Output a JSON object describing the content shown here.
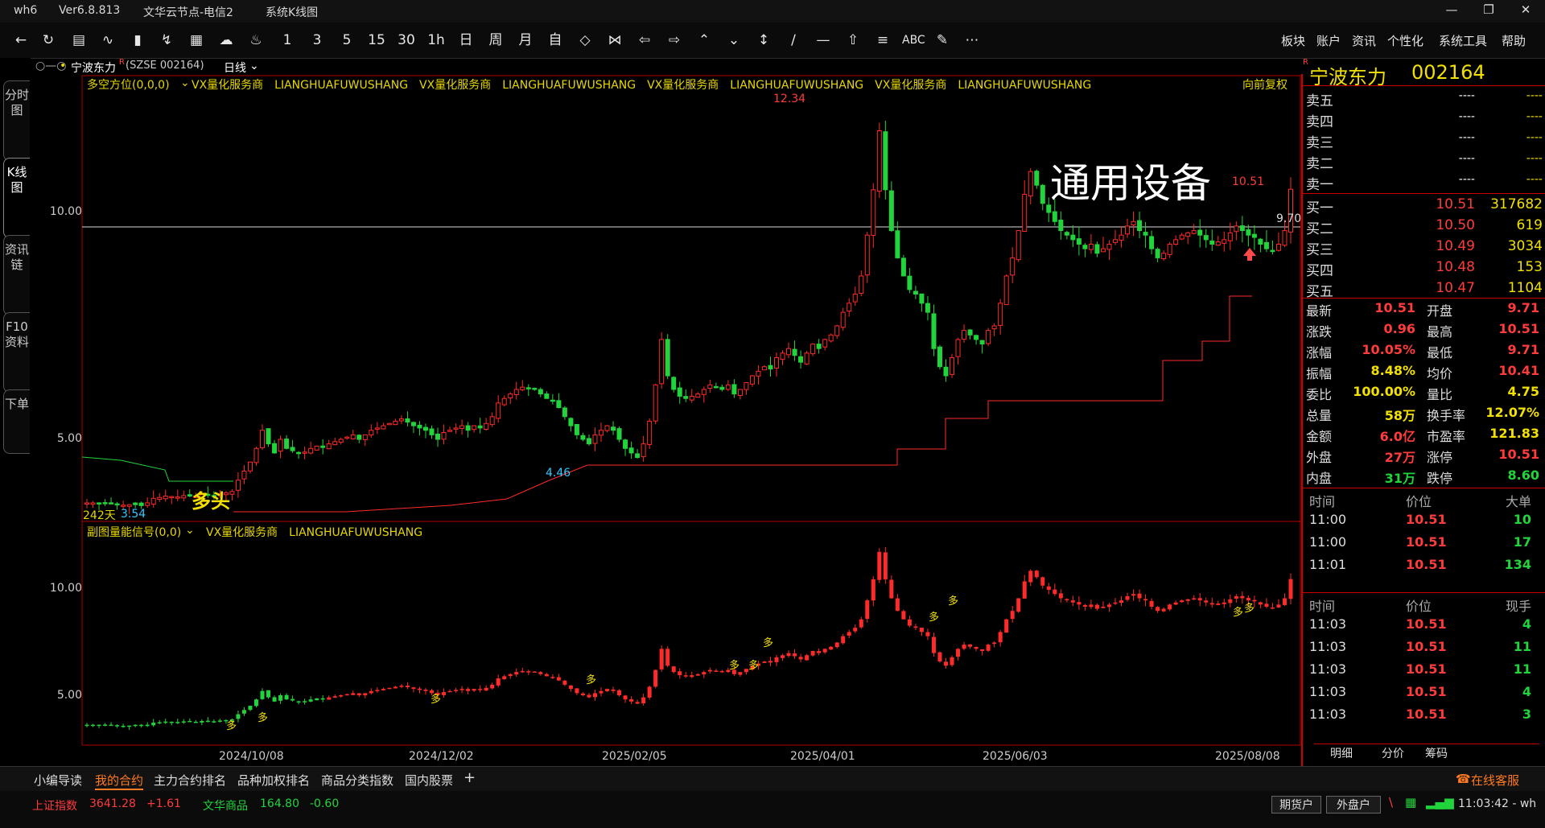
{
  "titlebar": {
    "app": "wh6",
    "version": "Ver6.8.813",
    "server": "文华云节点-电信2",
    "window": "系统K线图"
  },
  "toolbar": {
    "periods": [
      "1",
      "3",
      "5",
      "15",
      "30",
      "1h",
      "日",
      "周",
      "月",
      "自"
    ],
    "abc": "ABC",
    "right_menu": [
      "板块",
      "账户",
      "资讯",
      "个性化",
      "系统工具",
      "帮助"
    ]
  },
  "left_tabs": [
    "分时图",
    "K线图",
    "资讯链",
    "F10资料",
    "下单"
  ],
  "symbol": {
    "name": "宁波东力",
    "superscript": "R",
    "code": "(SZSE 002164)",
    "period": "日线"
  },
  "main_indicator": {
    "name": "多空方位(0,0,0)",
    "text": "VX量化服务商　LIANGHUAFUWUSHANG　VX量化服务商　LIANGHUAFUWUSHANG　VX量化服务商　LIANGHUAFUWUSHANG　VX量化服务商　LIANGHUAFUWUSHANG",
    "adjust": "向前复权"
  },
  "sub_indicator": {
    "name": "副图量能信号(0,0)",
    "text": "VX量化服务商　LIANGHUAFUWUSHANG"
  },
  "annotations": {
    "industry": "通用设备",
    "high": "12.34",
    "low": "4.46",
    "last": "10.51",
    "hline": "9.70",
    "days": "242天",
    "left_val": "3.54",
    "duotou": "多头",
    "duo": "多"
  },
  "yaxis_main": [
    "10.00",
    "5.00"
  ],
  "yaxis_sub": [
    "10.00",
    "5.00"
  ],
  "xaxis": [
    "2024/10/08",
    "2024/12/02",
    "2025/02/05",
    "2025/04/01",
    "2025/06/03",
    "2025/08/08"
  ],
  "quote_header": {
    "name": "宁波东力",
    "code": "002164",
    "flag": "R"
  },
  "orderbook": {
    "sells": [
      {
        "k": "卖五",
        "p": "----",
        "v": "----"
      },
      {
        "k": "卖四",
        "p": "----",
        "v": "----"
      },
      {
        "k": "卖三",
        "p": "----",
        "v": "----"
      },
      {
        "k": "卖二",
        "p": "----",
        "v": "----"
      },
      {
        "k": "卖一",
        "p": "----",
        "v": "----"
      }
    ],
    "buys": [
      {
        "k": "买一",
        "p": "10.51",
        "v": "317682"
      },
      {
        "k": "买二",
        "p": "10.50",
        "v": "619"
      },
      {
        "k": "买三",
        "p": "10.49",
        "v": "3034"
      },
      {
        "k": "买四",
        "p": "10.48",
        "v": "153"
      },
      {
        "k": "买五",
        "p": "10.47",
        "v": "1104"
      }
    ]
  },
  "stats": [
    {
      "k1": "最新",
      "v1": "10.51",
      "c1": "red",
      "k2": "开盘",
      "v2": "9.71",
      "c2": "red"
    },
    {
      "k1": "涨跌",
      "v1": "0.96",
      "c1": "red",
      "k2": "最高",
      "v2": "10.51",
      "c2": "red"
    },
    {
      "k1": "涨幅",
      "v1": "10.05%",
      "c1": "red",
      "k2": "最低",
      "v2": "9.71",
      "c2": "red"
    },
    {
      "k1": "振幅",
      "v1": "8.48%",
      "c1": "yel",
      "k2": "均价",
      "v2": "10.41",
      "c2": "red"
    },
    {
      "k1": "委比",
      "v1": "100.00%",
      "c1": "yel",
      "k2": "量比",
      "v2": "4.75",
      "c2": "yel"
    },
    {
      "k1": "总量",
      "v1": "58万",
      "c1": "yel",
      "k2": "换手率",
      "v2": "12.07%",
      "c2": "yel"
    },
    {
      "k1": "金额",
      "v1": "6.0亿",
      "c1": "red",
      "k2": "市盈率",
      "v2": "121.83",
      "c2": "yel"
    },
    {
      "k1": "外盘",
      "v1": "27万",
      "c1": "red",
      "k2": "涨停",
      "v2": "10.51",
      "c2": "red"
    },
    {
      "k1": "内盘",
      "v1": "31万",
      "c1": "green",
      "k2": "跌停",
      "v2": "8.60",
      "c2": "green"
    }
  ],
  "big_trades": {
    "headers": [
      "时间",
      "价位",
      "大单"
    ],
    "rows": [
      {
        "t": "11:00",
        "p": "10.51",
        "v": "10"
      },
      {
        "t": "11:00",
        "p": "10.51",
        "v": "17"
      },
      {
        "t": "11:01",
        "p": "10.51",
        "v": "134"
      }
    ]
  },
  "ticks": {
    "headers": [
      "时间",
      "价位",
      "现手"
    ],
    "rows": [
      {
        "t": "11:03",
        "p": "10.51",
        "v": "4"
      },
      {
        "t": "11:03",
        "p": "10.51",
        "v": "11"
      },
      {
        "t": "11:03",
        "p": "10.51",
        "v": "11"
      },
      {
        "t": "11:03",
        "p": "10.51",
        "v": "4"
      },
      {
        "t": "11:03",
        "p": "10.51",
        "v": "3"
      }
    ]
  },
  "panel_tabs": [
    "明细",
    "分价",
    "筹码"
  ],
  "online_service": "在线客服",
  "bottom_tabs": [
    "小编导读",
    "我的合约",
    "主力合约排名",
    "品种加权排名",
    "商品分类指数",
    "国内股票"
  ],
  "status": {
    "idx1_name": "上证指数",
    "idx1_val": "3641.28",
    "idx1_chg": "+1.61",
    "idx2_name": "文华商品",
    "idx2_val": "164.80",
    "idx2_chg": "-0.60",
    "btn1": "期货户",
    "btn2": "外盘户",
    "time": "11:03:42 - wh"
  },
  "colors": {
    "up": "#ff2a2a",
    "down": "#22d43c",
    "accent": "#e6d600",
    "border": "#c00000"
  },
  "chart_data": {
    "type": "candlestick",
    "closes": [
      3.6,
      3.6,
      3.6,
      3.58,
      3.58,
      3.57,
      3.55,
      3.56,
      3.56,
      3.54,
      3.6,
      3.7,
      3.72,
      3.75,
      3.74,
      3.73,
      3.76,
      3.75,
      3.74,
      3.78,
      3.77,
      3.76,
      3.8,
      3.82,
      3.85,
      4.1,
      4.3,
      4.5,
      4.8,
      5.2,
      4.9,
      4.7,
      5.0,
      4.8,
      4.75,
      4.7,
      4.72,
      4.8,
      4.85,
      4.82,
      4.9,
      4.95,
      5.0,
      5.05,
      5.1,
      5.0,
      5.1,
      5.2,
      5.25,
      5.3,
      5.35,
      5.4,
      5.45,
      5.38,
      5.3,
      5.25,
      5.2,
      5.1,
      5.0,
      5.15,
      5.2,
      5.25,
      5.3,
      5.2,
      5.3,
      5.25,
      5.35,
      5.5,
      5.8,
      5.9,
      6.0,
      6.1,
      6.15,
      6.12,
      6.1,
      6.0,
      5.9,
      5.85,
      5.7,
      5.5,
      5.3,
      5.1,
      5.0,
      4.9,
      5.1,
      5.2,
      5.3,
      5.2,
      5.0,
      4.8,
      4.7,
      4.6,
      4.9,
      5.4,
      6.2,
      7.2,
      6.4,
      6.1,
      5.95,
      5.9,
      5.95,
      6.0,
      6.1,
      6.2,
      6.15,
      6.1,
      6.2,
      6.0,
      6.1,
      6.25,
      6.4,
      6.5,
      6.6,
      6.55,
      6.8,
      6.9,
      7.0,
      6.85,
      6.7,
      6.9,
      7.1,
      7.0,
      7.2,
      7.3,
      7.5,
      7.8,
      8.0,
      8.2,
      8.6,
      9.5,
      10.5,
      11.8,
      10.5,
      9.6,
      9.0,
      8.6,
      8.3,
      8.2,
      8.0,
      7.8,
      7.0,
      6.6,
      6.4,
      6.8,
      7.2,
      7.4,
      7.3,
      7.2,
      7.1,
      7.4,
      7.5,
      8.0,
      8.6,
      9.0,
      9.6,
      10.4,
      10.9,
      10.6,
      10.2,
      10.0,
      9.8,
      9.6,
      9.5,
      9.4,
      9.3,
      9.2,
      9.3,
      9.1,
      9.2,
      9.3,
      9.4,
      9.5,
      9.7,
      9.8,
      9.6,
      9.5,
      9.2,
      9.0,
      9.1,
      9.3,
      9.4,
      9.5,
      9.55,
      9.6,
      9.5,
      9.4,
      9.3,
      9.35,
      9.4,
      9.55,
      9.7,
      9.6,
      9.5,
      9.45,
      9.3,
      9.2,
      9.15,
      9.3,
      9.6,
      10.51
    ]
  }
}
